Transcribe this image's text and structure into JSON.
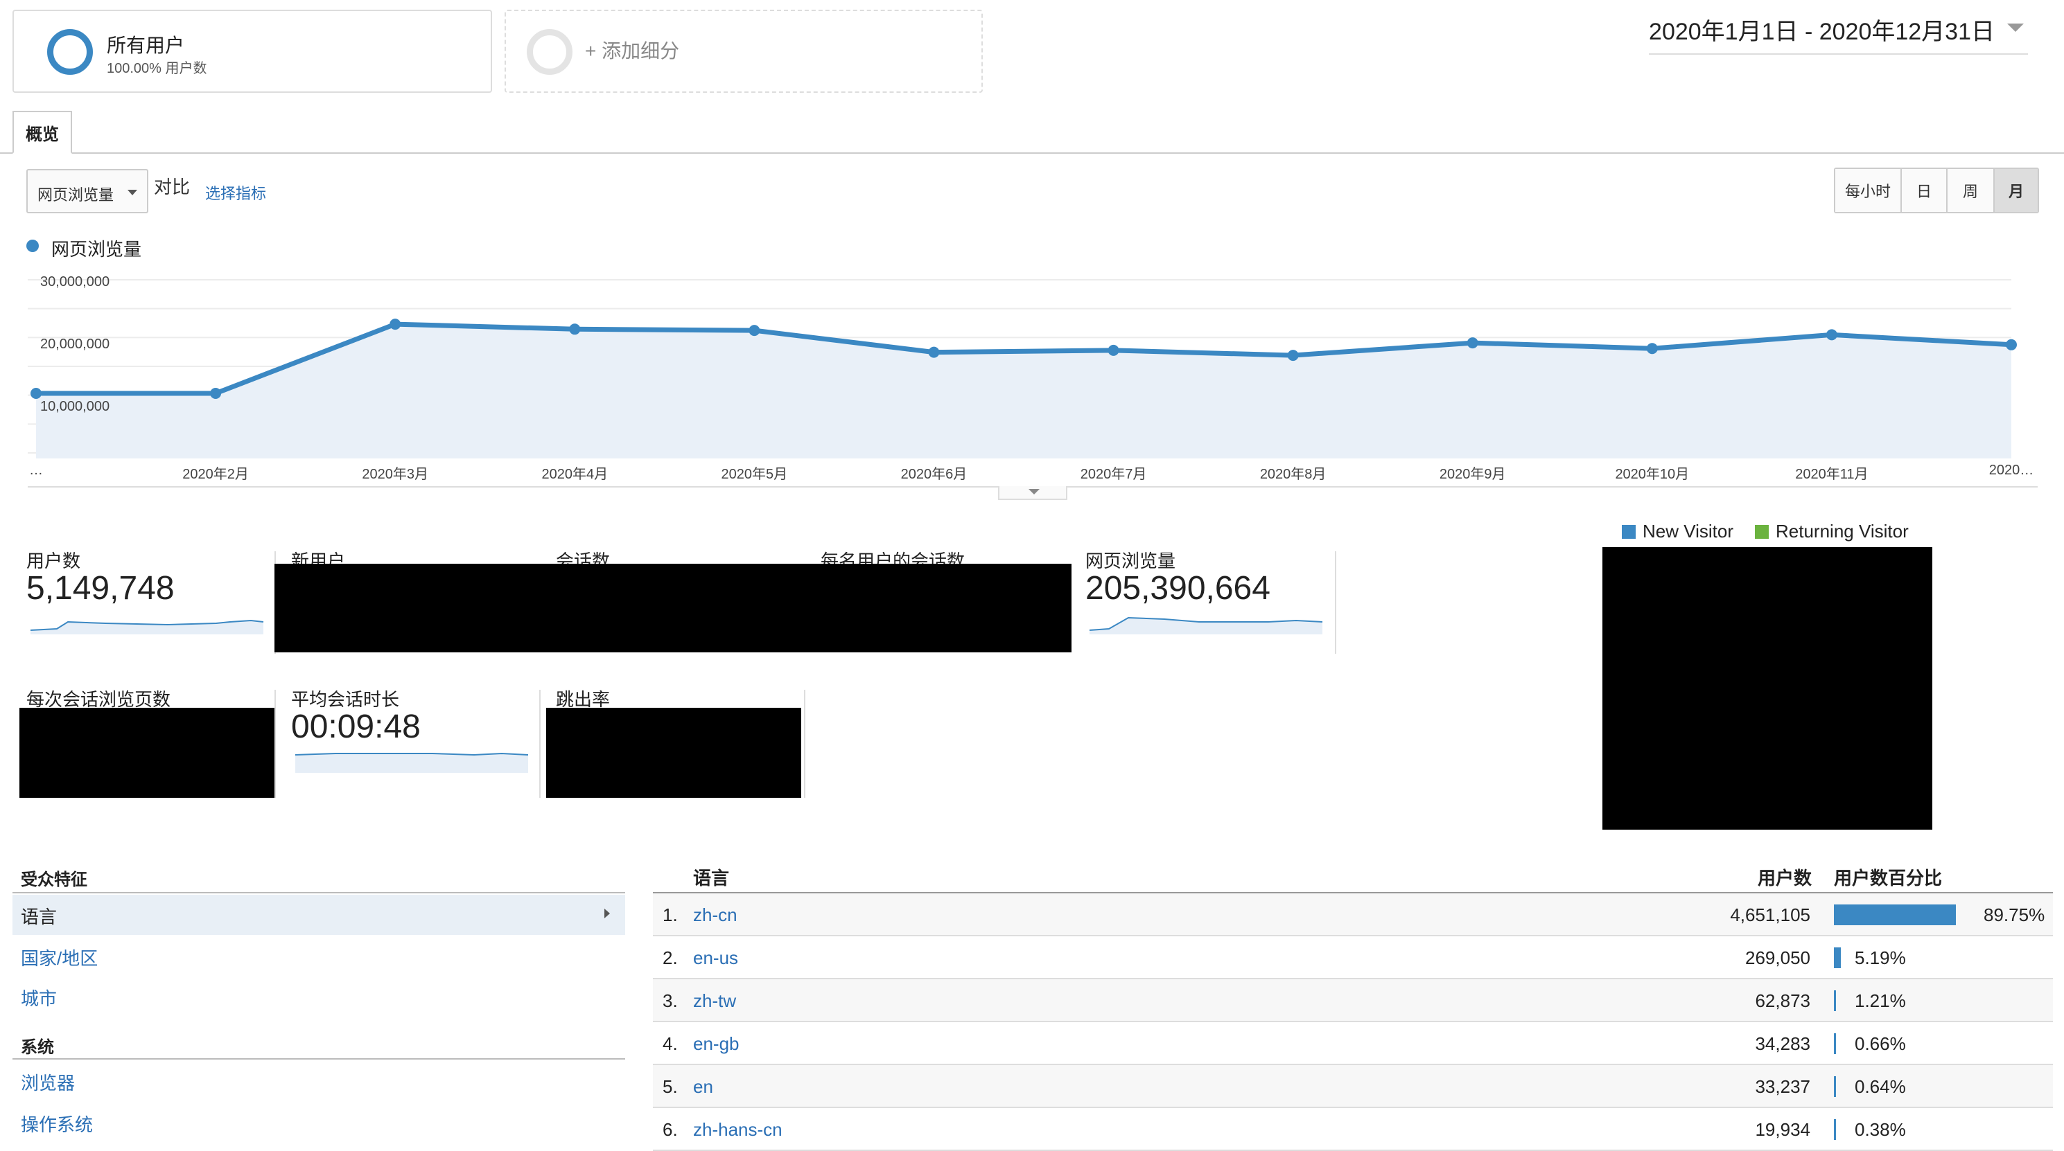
{
  "segments": {
    "all_users_title": "所有用户",
    "all_users_sub": "100.00% 用户数",
    "add_segment": "+ 添加细分"
  },
  "date_range": "2020年1月1日 - 2020年12月31日",
  "tabs": {
    "overview": "概览"
  },
  "controls": {
    "metric_select": "网页浏览量",
    "vs_label": "对比",
    "choose_metric": "选择指标",
    "periods": [
      "每小时",
      "日",
      "周",
      "月"
    ],
    "active_period": "月"
  },
  "chart_data": {
    "type": "area",
    "series": [
      {
        "name": "网页浏览量",
        "values": [
          10500000,
          10500000,
          21600000,
          20800000,
          20600000,
          17100000,
          17400000,
          16600000,
          18600000,
          17700000,
          19900000,
          18300000
        ]
      }
    ],
    "x": [
      "…",
      "2020年2月",
      "2020年3月",
      "2020年4月",
      "2020年5月",
      "2020年6月",
      "2020年7月",
      "2020年8月",
      "2020年9月",
      "2020年10月",
      "2020年11月",
      "2020…"
    ],
    "yticks": [
      "30,000,000",
      "20,000,000",
      "10,000,000"
    ],
    "ylim": [
      0,
      30000000
    ],
    "grid": true,
    "legend": "top-left",
    "color": "#3b88c3",
    "fill": "#e9f0f8"
  },
  "metrics": {
    "users_label": "用户数",
    "users_value": "5,149,748",
    "new_users_label": "新用户",
    "sessions_label": "会话数",
    "sessions_per_user_label": "每名用户的会话数",
    "pageviews_label": "网页浏览量",
    "pageviews_value": "205,390,664",
    "pages_per_session_label": "每次会话浏览页数",
    "avg_duration_label": "平均会话时长",
    "avg_duration_value": "00:09:48",
    "bounce_rate_label": "跳出率"
  },
  "pie_legend": {
    "new_visitor": "New Visitor",
    "returning_visitor": "Returning Visitor",
    "new_color": "#3b88c3",
    "returning_color": "#6bb33f"
  },
  "audience": {
    "demographics_head": "受众特征",
    "language": "语言",
    "country": "国家/地区",
    "city": "城市",
    "system_head": "系统",
    "browser": "浏览器",
    "os": "操作系统"
  },
  "table": {
    "col_language": "语言",
    "col_users": "用户数",
    "col_pct": "用户数百分比",
    "rows": [
      {
        "rank": "1.",
        "lang": "zh-cn",
        "users": "4,651,105",
        "pct": "89.75%",
        "share": 0.8975
      },
      {
        "rank": "2.",
        "lang": "en-us",
        "users": "269,050",
        "pct": "5.19%",
        "share": 0.0519
      },
      {
        "rank": "3.",
        "lang": "zh-tw",
        "users": "62,873",
        "pct": "1.21%",
        "share": 0.0121
      },
      {
        "rank": "4.",
        "lang": "en-gb",
        "users": "34,283",
        "pct": "0.66%",
        "share": 0.0066
      },
      {
        "rank": "5.",
        "lang": "en",
        "users": "33,237",
        "pct": "0.64%",
        "share": 0.0064
      },
      {
        "rank": "6.",
        "lang": "zh-hans-cn",
        "users": "19,934",
        "pct": "0.38%",
        "share": 0.0038
      }
    ]
  }
}
